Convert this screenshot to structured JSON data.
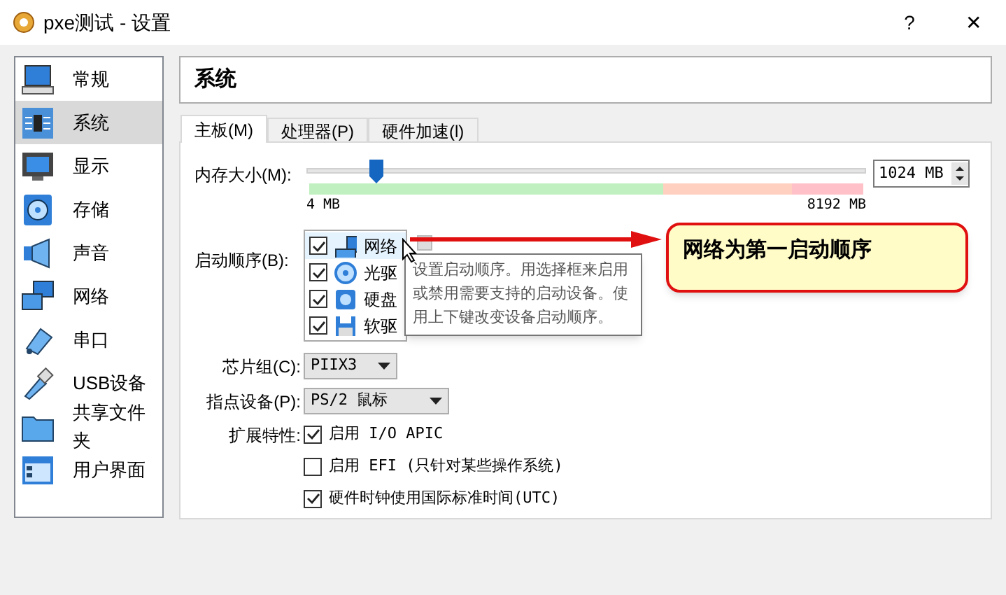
{
  "window": {
    "title": "pxe测试 - 设置",
    "help_button": "?",
    "close_button": "✕"
  },
  "sidebar": {
    "items": [
      {
        "label": "常规",
        "kind": "general",
        "selected": false
      },
      {
        "label": "系统",
        "kind": "system",
        "selected": true
      },
      {
        "label": "显示",
        "kind": "display",
        "selected": false
      },
      {
        "label": "存储",
        "kind": "storage",
        "selected": false
      },
      {
        "label": "声音",
        "kind": "audio",
        "selected": false
      },
      {
        "label": "网络",
        "kind": "network",
        "selected": false
      },
      {
        "label": "串口",
        "kind": "serial",
        "selected": false
      },
      {
        "label": "USB设备",
        "kind": "usb",
        "selected": false
      },
      {
        "label": "共享文件夹",
        "kind": "folder",
        "selected": false
      },
      {
        "label": "用户界面",
        "kind": "ui",
        "selected": false
      }
    ]
  },
  "header": "系统",
  "tabs": [
    {
      "label": "主板(M)",
      "selected": true
    },
    {
      "label": "处理器(P)",
      "selected": false
    },
    {
      "label": "硬件加速(l)",
      "selected": false
    }
  ],
  "memory": {
    "label": "内存大小(M):",
    "level": 0.125,
    "value": "1024 MB",
    "min_label": "4 MB",
    "max_label": "8192 MB"
  },
  "boot_order": {
    "label": "启动顺序(B):",
    "items": [
      {
        "label": "网络",
        "kind": "network",
        "checked": true
      },
      {
        "label": "光驱",
        "kind": "optical",
        "checked": true
      },
      {
        "label": "硬盘",
        "kind": "disk",
        "checked": true
      },
      {
        "label": "软驱",
        "kind": "floppy",
        "checked": true
      }
    ]
  },
  "tooltip": "设置启动顺序。用选择框来启用或禁用需要支持的启动设备。使用上下键改变设备启动顺序。",
  "annotation": "网络为第一启动顺序",
  "chipset": {
    "label": "芯片组(C):",
    "value": "PIIX3"
  },
  "pointing_device": {
    "label": "指点设备(P):",
    "value": "PS/2 鼠标"
  },
  "extended_features": {
    "label": "扩展特性:",
    "options": [
      {
        "label": "启用 I/O APIC",
        "checked": true
      },
      {
        "label": "启用 EFI (只针对某些操作系统)",
        "checked": false
      },
      {
        "label": "硬件时钟使用国际标准时间(UTC)",
        "checked": true
      }
    ]
  }
}
